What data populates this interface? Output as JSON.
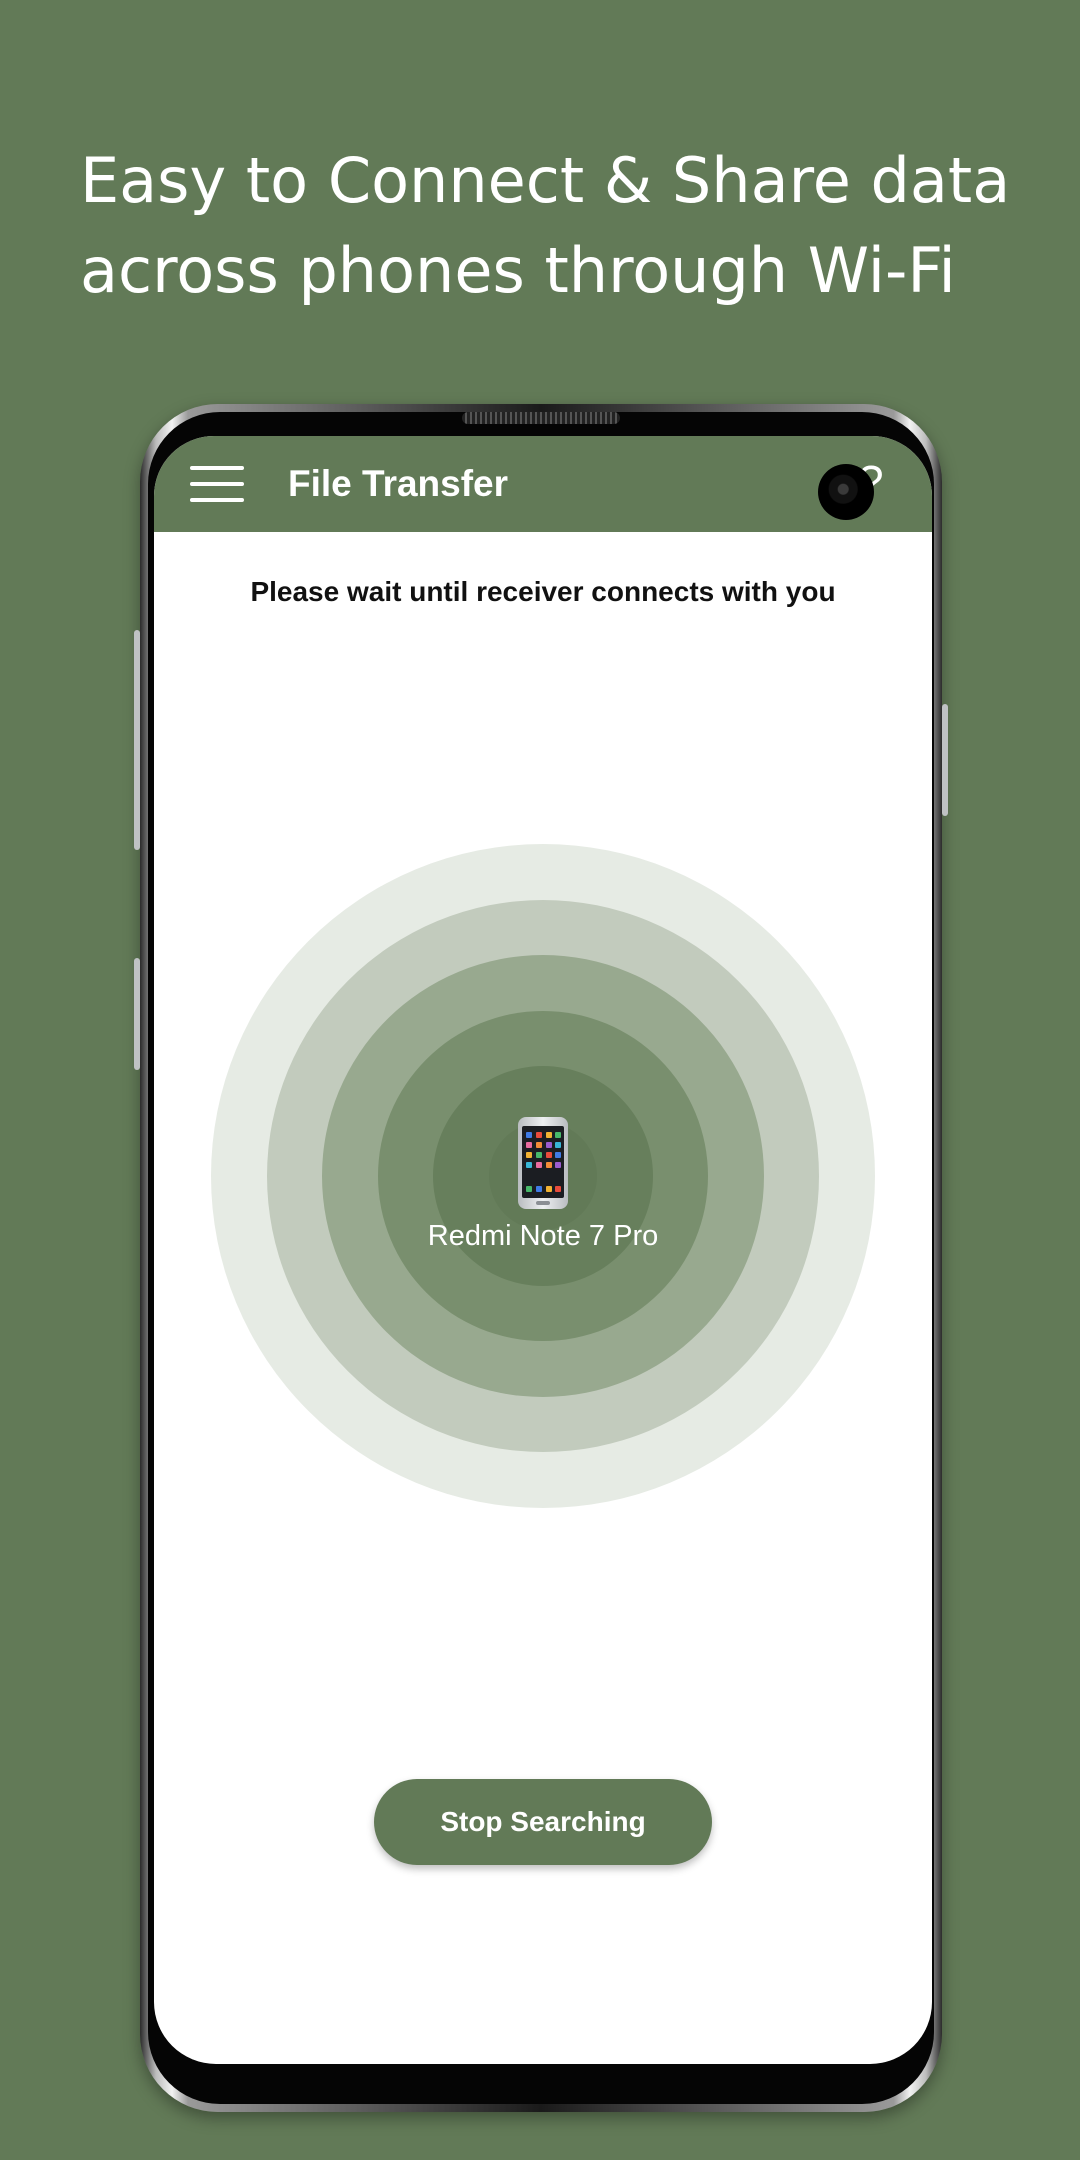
{
  "headline": {
    "line1": "Easy to Connect & Share data",
    "line2": "across phones through Wi-Fi"
  },
  "appbar": {
    "menu_icon": "hamburger-menu-icon",
    "title": "File Transfer",
    "help_icon": "help-icon",
    "help_glyph": "?"
  },
  "main": {
    "instruction": "Please wait until receiver connects with you",
    "device_icon": "mobile-phone-icon",
    "device_name": "Redmi Note 7 Pro"
  },
  "actions": {
    "stop_label": "Stop Searching"
  },
  "colors": {
    "brand": "#627a57",
    "background": "#627a57",
    "screen": "#ffffff"
  }
}
